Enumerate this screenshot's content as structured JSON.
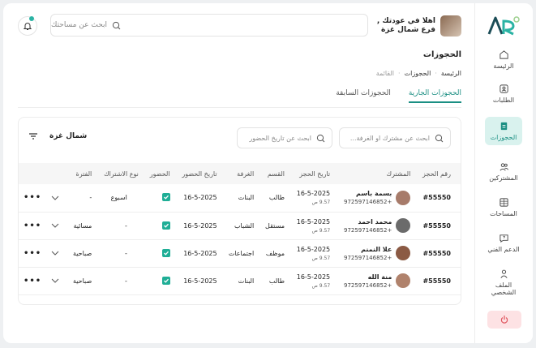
{
  "sidebar": {
    "items": [
      {
        "label": "الرئيسة",
        "icon": "home-icon"
      },
      {
        "label": "الطلبات",
        "icon": "requests-icon"
      },
      {
        "label": "الحجوزات",
        "icon": "bookings-icon"
      },
      {
        "label": "المشتركين",
        "icon": "members-icon"
      },
      {
        "label": "المساحات",
        "icon": "spaces-icon"
      },
      {
        "label": "الدعم الفني",
        "icon": "support-icon"
      },
      {
        "label": "الملف الشخصي",
        "icon": "profile-icon"
      }
    ],
    "active_index": 2
  },
  "header": {
    "search_placeholder": "ابحث عن مساحتك",
    "user_greeting": "اهلا في عودتك ,",
    "user_branch": "فرع شمال غزة"
  },
  "page": {
    "title": "الحجوزات",
    "breadcrumb": [
      "الرئيسة",
      "الحجوزات",
      "القائمة"
    ]
  },
  "tabs": [
    {
      "label": "الحجوزات الجارية",
      "active": true
    },
    {
      "label": "الحجوزات السابقة",
      "active": false
    }
  ],
  "filters": {
    "search_member_placeholder": "ابحث عن مشترك او الغرفة...",
    "search_date_placeholder": "ابحث عن تاريخ الحضور",
    "branch_label": "شمال غزة"
  },
  "table": {
    "columns": [
      "رقم الحجز",
      "المشترك",
      "تاريخ الحجز",
      "القسم",
      "الغرفة",
      "تاريخ الحضور",
      "الحضور",
      "نوع الاشتراك",
      "الفترة"
    ],
    "rows": [
      {
        "id": "#55550",
        "name": "بسمة باسم",
        "phone": "+972597146852",
        "date": "16-5-2025",
        "time": "9.57 ص",
        "section": "طالب",
        "room": "البنات",
        "attend_date": "16-5-2025",
        "attended": true,
        "sub_type": "اسبوع",
        "period": "-"
      },
      {
        "id": "#55550",
        "name": "محمد احمد",
        "phone": "+972597146852",
        "date": "16-5-2025",
        "time": "9.57 ص",
        "section": "مستقل",
        "room": "الشباب",
        "attend_date": "16-5-2025",
        "attended": true,
        "sub_type": "-",
        "period": "مسائية"
      },
      {
        "id": "#55550",
        "name": "علا النمنم",
        "phone": "+972597146852",
        "date": "16-5-2025",
        "time": "9.57 ص",
        "section": "موظف",
        "room": "اجتماعات",
        "attend_date": "16-5-2025",
        "attended": true,
        "sub_type": "-",
        "period": "صباحية"
      },
      {
        "id": "#55550",
        "name": "منة الله",
        "phone": "+972597146852",
        "date": "16-5-2025",
        "time": "9.57 ص",
        "section": "طالب",
        "room": "البنات",
        "attend_date": "16-5-2025",
        "attended": true,
        "sub_type": "-",
        "period": "صباحية"
      }
    ]
  },
  "colors": {
    "accent": "#1b8f83",
    "check": "#1fae96",
    "logout_bg": "#fde2e4"
  }
}
